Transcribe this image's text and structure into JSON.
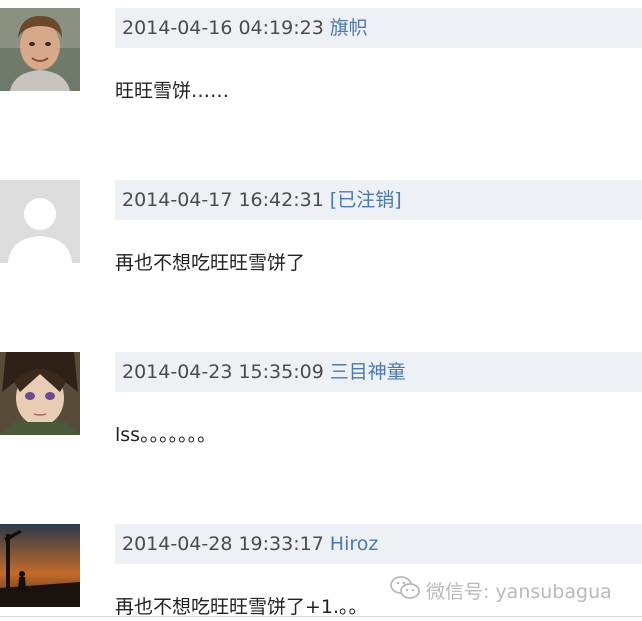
{
  "comments": [
    {
      "timestamp": "2014-04-16 04:19:23",
      "author": "旗帜",
      "text": "旺旺雪饼……",
      "avatar": "photo-avatar-man"
    },
    {
      "timestamp": "2014-04-17 16:42:31",
      "author": "[已注销]",
      "text": "再也不想吃旺旺雪饼了",
      "avatar": "default-avatar"
    },
    {
      "timestamp": "2014-04-23 15:35:09",
      "author": "三目神童",
      "text": "lss。。。。。。。",
      "avatar": "anime-avatar"
    },
    {
      "timestamp": "2014-04-28 19:33:17",
      "author": "Hiroz",
      "text": "再也不想吃旺旺雪饼了+1.。。",
      "avatar": "sunset-silhouette-avatar"
    }
  ],
  "watermark": {
    "text": "微信号: yansubagua",
    "icon": "wechat-icon"
  },
  "colors": {
    "meta_bg": "#edf0f5",
    "author_link": "#4d79a8",
    "timestamp": "#4b4b4b",
    "watermark": "#b9b9b9"
  }
}
